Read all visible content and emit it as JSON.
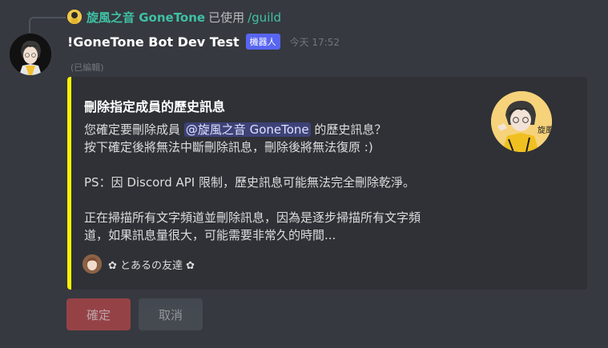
{
  "reply": {
    "user": "旋風之音 GoneTone",
    "verb": "已使用",
    "command": "/guild"
  },
  "message": {
    "username": "!GoneTone Bot Dev Test",
    "bot_tag": "機器人",
    "timestamp": "今天 17:52",
    "edited": "(已編輯)"
  },
  "embed": {
    "accent_color": "#fff200",
    "title": "刪除指定成員的歷史訊息",
    "desc_line1_prefix": "您確定要刪除成員",
    "desc_mention": "@旋風之音 GoneTone",
    "desc_line1_suffix": "的歷史訊息？",
    "desc_line2": "按下確定後將無法中斷刪除訊息，刪除後將無法復原 :)",
    "desc_line3": "PS：因 Discord API 限制，歷史訊息可能無法完全刪除乾淨。",
    "desc_line4": "正在掃描所有文字頻道並刪除訊息，因為是逐步掃描所有文字頻",
    "desc_line5": "道，如果訊息量很大，可能需要非常久的時間...",
    "footer_text": "✿ とあるの友達 ✿",
    "thumbnail_label": "旋風"
  },
  "buttons": {
    "confirm": "確定",
    "cancel": "取消"
  }
}
